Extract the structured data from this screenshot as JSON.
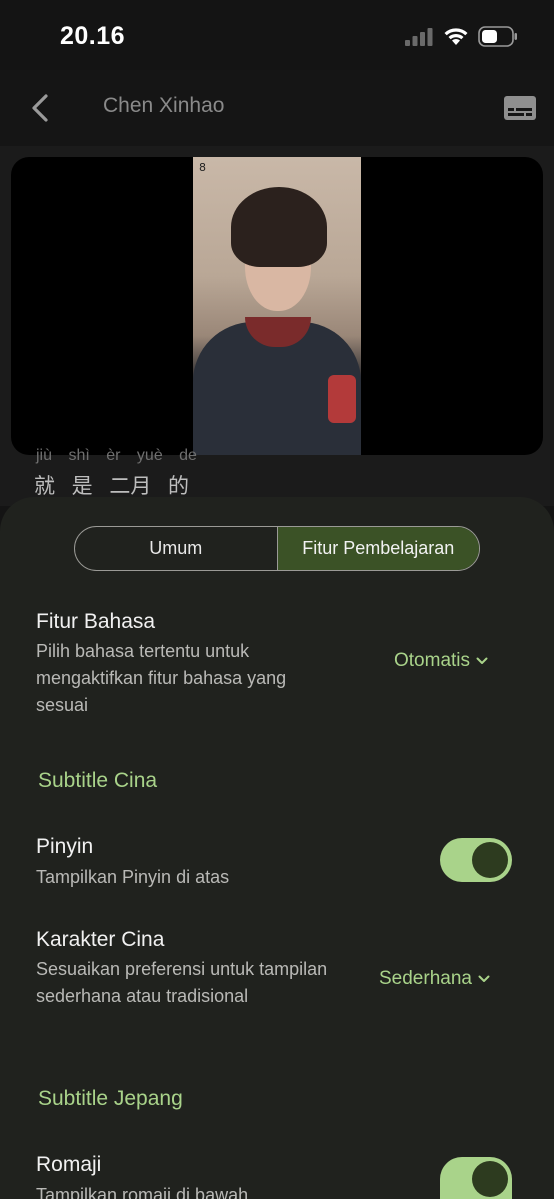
{
  "status_bar": {
    "time": "20.16"
  },
  "header": {
    "title": "Chen Xinhao"
  },
  "video": {
    "watermark": "8"
  },
  "lyrics": {
    "pinyin": "jiù  shì  èr yuè  de",
    "hanzi": "就 是 二月 的"
  },
  "tabs": [
    {
      "label": "Umum",
      "active": false
    },
    {
      "label": "Fitur Pembelajaran",
      "active": true
    }
  ],
  "language_feature": {
    "title": "Fitur Bahasa",
    "description": "Pilih bahasa tertentu untuk mengaktifkan fitur bahasa yang sesuai",
    "value": "Otomatis"
  },
  "chinese_section": {
    "title": "Subtitle Cina",
    "pinyin": {
      "title": "Pinyin",
      "description": "Tampilkan Pinyin di atas",
      "enabled": true
    },
    "characters": {
      "title": "Karakter Cina",
      "description": "Sesuaikan preferensi untuk tampilan sederhana atau tradisional",
      "value": "Sederhana"
    }
  },
  "japanese_section": {
    "title": "Subtitle Jepang",
    "romaji": {
      "title": "Romaji",
      "description": "Tampilkan romaji di bawah",
      "enabled": true
    }
  },
  "colors": {
    "accent": "#a9d38a",
    "active_tab": "#3b5226",
    "sheet": "#20221e"
  }
}
